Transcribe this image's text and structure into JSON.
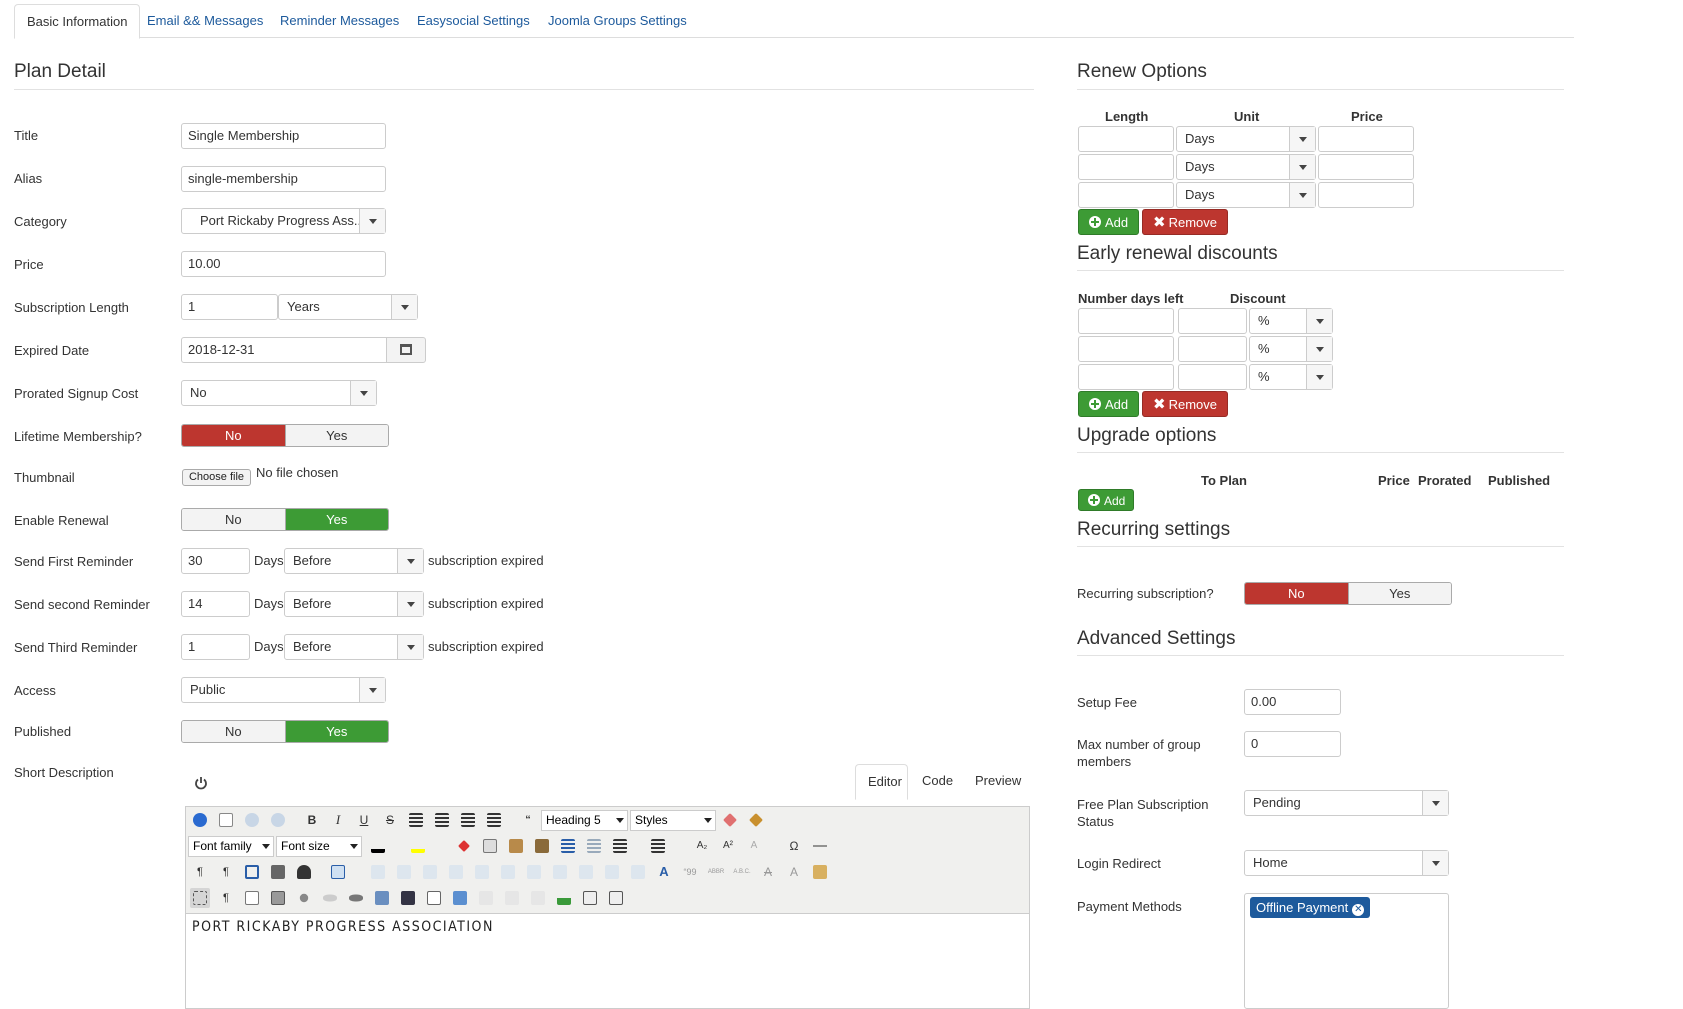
{
  "tabs": [
    "Basic Information",
    "Email && Messages",
    "Reminder Messages",
    "Easysocial Settings",
    "Joomla Groups Settings"
  ],
  "plan": {
    "heading": "Plan Detail",
    "title_label": "Title",
    "title_value": "Single Membership",
    "alias_label": "Alias",
    "alias_value": "single-membership",
    "category_label": "Category",
    "category_value": "Port Rickaby Progress Ass...",
    "price_label": "Price",
    "price_value": "10.00",
    "length_label": "Subscription Length",
    "length_value": "1",
    "length_unit": "Years",
    "expired_label": "Expired Date",
    "expired_value": "2018-12-31",
    "prorated_label": "Prorated Signup Cost",
    "prorated_value": "No",
    "lifetime_label": "Lifetime Membership?",
    "thumbnail_label": "Thumbnail",
    "choose_file": "Choose file",
    "no_file": "No file chosen",
    "renewal_label": "Enable Renewal",
    "no": "No",
    "yes": "Yes",
    "reminders": [
      {
        "label": "Send First Reminder",
        "value": "30"
      },
      {
        "label": "Send second Reminder",
        "value": "14"
      },
      {
        "label": "Send Third Reminder",
        "value": "1"
      }
    ],
    "days": "Days",
    "before": "Before",
    "sub_expired": "subscription expired",
    "access_label": "Access",
    "access_value": "Public",
    "published_label": "Published",
    "short_desc_label": "Short Description"
  },
  "editor": {
    "tabs": [
      "Editor",
      "Code",
      "Preview"
    ],
    "heading_select": "Heading 5",
    "styles_select": "Styles",
    "font_family": "Font family",
    "font_size": "Font size",
    "content": "PORT RICKABY PROGRESS ASSOCIATION"
  },
  "renew": {
    "heading": "Renew Options",
    "col_length": "Length",
    "col_unit": "Unit",
    "col_price": "Price",
    "unit": "Days",
    "add": "Add",
    "remove": "Remove"
  },
  "early": {
    "heading": "Early renewal discounts",
    "col_days": "Number days left",
    "col_discount": "Discount",
    "pct": "%"
  },
  "upgrade": {
    "heading": "Upgrade options",
    "col_to_plan": "To Plan",
    "col_price": "Price",
    "col_prorated": "Prorated",
    "col_published": "Published"
  },
  "recurring": {
    "heading": "Recurring settings",
    "label": "Recurring subscription?"
  },
  "advanced": {
    "heading": "Advanced Settings",
    "setup_fee_label": "Setup Fee",
    "setup_fee_value": "0.00",
    "max_group_label_1": "Max number of group",
    "max_group_label_2": "members",
    "max_group_value": "0",
    "free_status_label_1": "Free Plan Subscription",
    "free_status_label_2": "Status",
    "free_status_value": "Pending",
    "login_redirect_label": "Login Redirect",
    "login_redirect_value": "Home",
    "payment_label": "Payment Methods",
    "payment_tag": "Offline Payment"
  },
  "colors": {
    "link": "#1d5a9c",
    "green": "#3d9b35",
    "red": "#bd362f"
  }
}
